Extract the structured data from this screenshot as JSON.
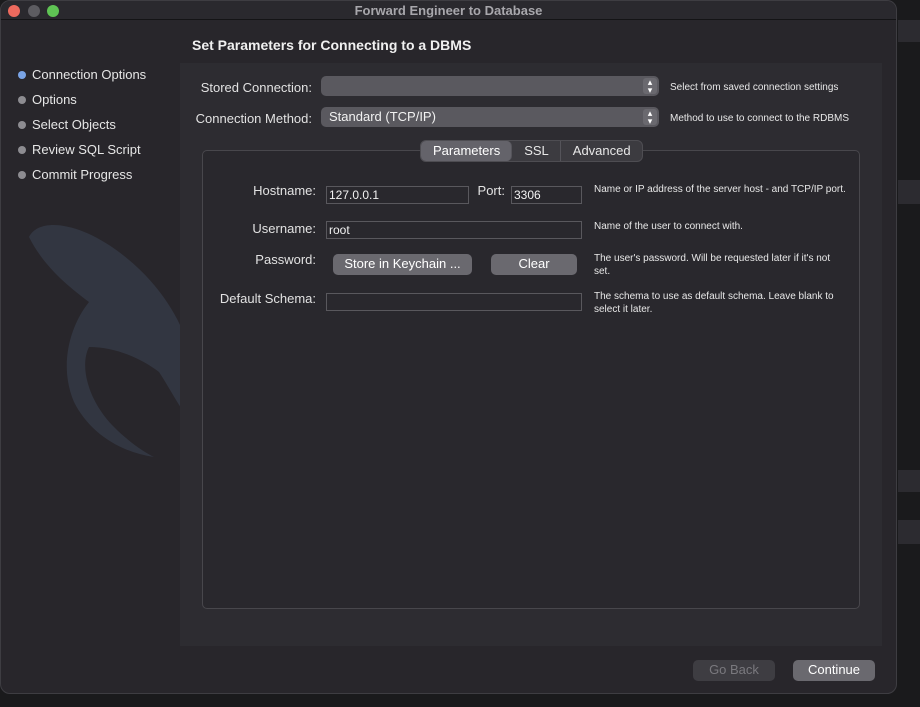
{
  "window": {
    "title": "Forward Engineer to Database"
  },
  "sidebar": {
    "steps": [
      {
        "label": "Connection Options"
      },
      {
        "label": "Options"
      },
      {
        "label": "Select Objects"
      },
      {
        "label": "Review SQL Script"
      },
      {
        "label": "Commit Progress"
      }
    ]
  },
  "main": {
    "heading": "Set Parameters for Connecting to a DBMS",
    "stored_connection": {
      "label": "Stored Connection:",
      "value": "",
      "hint": "Select from saved connection settings"
    },
    "connection_method": {
      "label": "Connection Method:",
      "value": "Standard (TCP/IP)",
      "hint": "Method to use to connect to the RDBMS"
    },
    "tabs": [
      "Parameters",
      "SSL",
      "Advanced"
    ],
    "hostname": {
      "label": "Hostname:",
      "value": "127.0.0.1"
    },
    "port": {
      "label": "Port:",
      "value": "3306"
    },
    "hostname_hint": "Name or IP address of the server host - and TCP/IP port.",
    "username": {
      "label": "Username:",
      "value": "root",
      "hint": "Name of the user to connect with."
    },
    "password": {
      "label": "Password:",
      "store_button": "Store in Keychain ...",
      "clear_button": "Clear",
      "hint": "The user's password. Will be requested later if it's not set."
    },
    "default_schema": {
      "label": "Default Schema:",
      "value": "",
      "hint": "The schema to use as default schema. Leave blank to select it later."
    }
  },
  "footer": {
    "go_back": "Go Back",
    "continue": "Continue"
  },
  "colors": {
    "accent": "#7aa4e6",
    "close": "#ed6a5e",
    "maximize": "#5fc454"
  }
}
